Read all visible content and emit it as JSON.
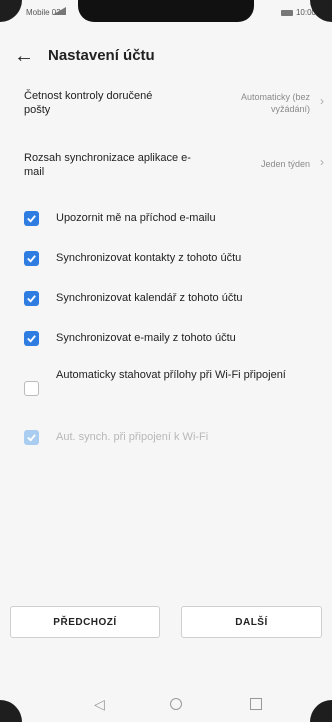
{
  "status_bar": {
    "carrier": "Mobile 02",
    "time": "10:00"
  },
  "header": {
    "back_icon": "arrow-left-icon",
    "title": "Nastavení účtu"
  },
  "settings": [
    {
      "label": "Četnost kontroly doručené pošty",
      "value": "Automaticky (bez vyžádání)"
    },
    {
      "label": "Rozsah synchronizace aplikace e-mail",
      "value": "Jeden týden"
    }
  ],
  "options": [
    {
      "label": "Upozornit mě na příchod e-mailu",
      "checked": true,
      "enabled": true
    },
    {
      "label": "Synchronizovat kontakty z tohoto účtu",
      "checked": true,
      "enabled": true
    },
    {
      "label": "Synchronizovat kalendář z tohoto účtu",
      "checked": true,
      "enabled": true
    },
    {
      "label": "Synchronizovat e-maily z tohoto účtu",
      "checked": true,
      "enabled": true
    },
    {
      "label": "Automaticky stahovat přílohy při Wi-Fi připojení",
      "checked": false,
      "enabled": true
    },
    {
      "label": "Aut. synch. při připojení k Wi-Fi",
      "checked": true,
      "enabled": false
    }
  ],
  "buttons": {
    "previous": "PŘEDCHOZÍ",
    "next": "DALŠÍ"
  },
  "colors": {
    "accent": "#2f7de1",
    "accent_disabled": "#a9ccf1"
  }
}
